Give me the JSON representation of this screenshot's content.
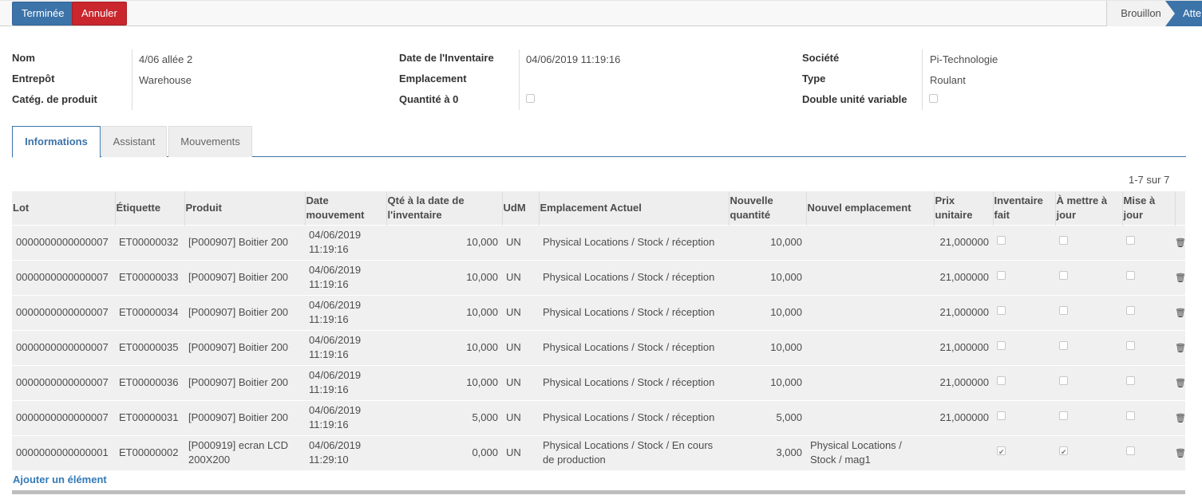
{
  "statusbar": {
    "done_label": "Terminée",
    "cancel_label": "Annuler",
    "stages": [
      "Brouillon",
      "Atte"
    ]
  },
  "header": {
    "col1": [
      {
        "label": "Nom",
        "value": "4/06 allée 2"
      },
      {
        "label": "Entrepôt",
        "value": "Warehouse"
      },
      {
        "label": "Catég. de produit",
        "value": ""
      }
    ],
    "col2": [
      {
        "label": "Date de l'Inventaire",
        "value": "04/06/2019 11:19:16"
      },
      {
        "label": "Emplacement",
        "value": ""
      },
      {
        "label": "Quantité à 0",
        "value": ""
      }
    ],
    "col3": [
      {
        "label": "Société",
        "value": "Pi-Technologie"
      },
      {
        "label": "Type",
        "value": "Roulant"
      },
      {
        "label": "Double unité variable",
        "value": ""
      }
    ]
  },
  "tabs": [
    "Informations",
    "Assistant",
    "Mouvements"
  ],
  "pager": "1-7 sur 7",
  "table": {
    "columns": [
      "Lot",
      "Étiquette",
      "Produit",
      "Date mouvement",
      "Qté à la date de l'inventaire",
      "UdM",
      "Emplacement Actuel",
      "Nouvelle quantité",
      "Nouvel emplacement",
      "Prix unitaire",
      "Inventaire fait",
      "À mettre à jour",
      "Mise à jour"
    ],
    "rows": [
      {
        "lot": "0000000000000007",
        "etiquette": "ET00000032",
        "produit": "[P000907] Boitier 200",
        "date": "04/06/2019 11:19:16",
        "qte": "10,000",
        "udm": "UN",
        "emplacement": "Physical Locations / Stock / réception",
        "nouvelle_qte": "10,000",
        "nouvel_emplacement": "",
        "prix": "21,000000",
        "inv_fait": false,
        "a_mettre": false,
        "mise": false
      },
      {
        "lot": "0000000000000007",
        "etiquette": "ET00000033",
        "produit": "[P000907] Boitier 200",
        "date": "04/06/2019 11:19:16",
        "qte": "10,000",
        "udm": "UN",
        "emplacement": "Physical Locations / Stock / réception",
        "nouvelle_qte": "10,000",
        "nouvel_emplacement": "",
        "prix": "21,000000",
        "inv_fait": false,
        "a_mettre": false,
        "mise": false
      },
      {
        "lot": "0000000000000007",
        "etiquette": "ET00000034",
        "produit": "[P000907] Boitier 200",
        "date": "04/06/2019 11:19:16",
        "qte": "10,000",
        "udm": "UN",
        "emplacement": "Physical Locations / Stock / réception",
        "nouvelle_qte": "10,000",
        "nouvel_emplacement": "",
        "prix": "21,000000",
        "inv_fait": false,
        "a_mettre": false,
        "mise": false
      },
      {
        "lot": "0000000000000007",
        "etiquette": "ET00000035",
        "produit": "[P000907] Boitier 200",
        "date": "04/06/2019 11:19:16",
        "qte": "10,000",
        "udm": "UN",
        "emplacement": "Physical Locations / Stock / réception",
        "nouvelle_qte": "10,000",
        "nouvel_emplacement": "",
        "prix": "21,000000",
        "inv_fait": false,
        "a_mettre": false,
        "mise": false
      },
      {
        "lot": "0000000000000007",
        "etiquette": "ET00000036",
        "produit": "[P000907] Boitier 200",
        "date": "04/06/2019 11:19:16",
        "qte": "10,000",
        "udm": "UN",
        "emplacement": "Physical Locations / Stock / réception",
        "nouvelle_qte": "10,000",
        "nouvel_emplacement": "",
        "prix": "21,000000",
        "inv_fait": false,
        "a_mettre": false,
        "mise": false
      },
      {
        "lot": "0000000000000007",
        "etiquette": "ET00000031",
        "produit": "[P000907] Boitier 200",
        "date": "04/06/2019 11:19:16",
        "qte": "5,000",
        "udm": "UN",
        "emplacement": "Physical Locations / Stock / réception",
        "nouvelle_qte": "5,000",
        "nouvel_emplacement": "",
        "prix": "21,000000",
        "inv_fait": false,
        "a_mettre": false,
        "mise": false
      },
      {
        "lot": "0000000000000001",
        "etiquette": "ET00000002",
        "produit": "[P000919] ecran LCD 200X200",
        "date": "04/06/2019 11:29:10",
        "qte": "0,000",
        "udm": "UN",
        "emplacement": "Physical Locations / Stock / En cours de production",
        "nouvelle_qte": "3,000",
        "nouvel_emplacement": "Physical Locations / Stock / mag1",
        "prix": "",
        "inv_fait": true,
        "a_mettre": true,
        "mise": false
      }
    ],
    "add_label": "Ajouter un élément"
  },
  "icons": {
    "delete": "trash-icon"
  }
}
